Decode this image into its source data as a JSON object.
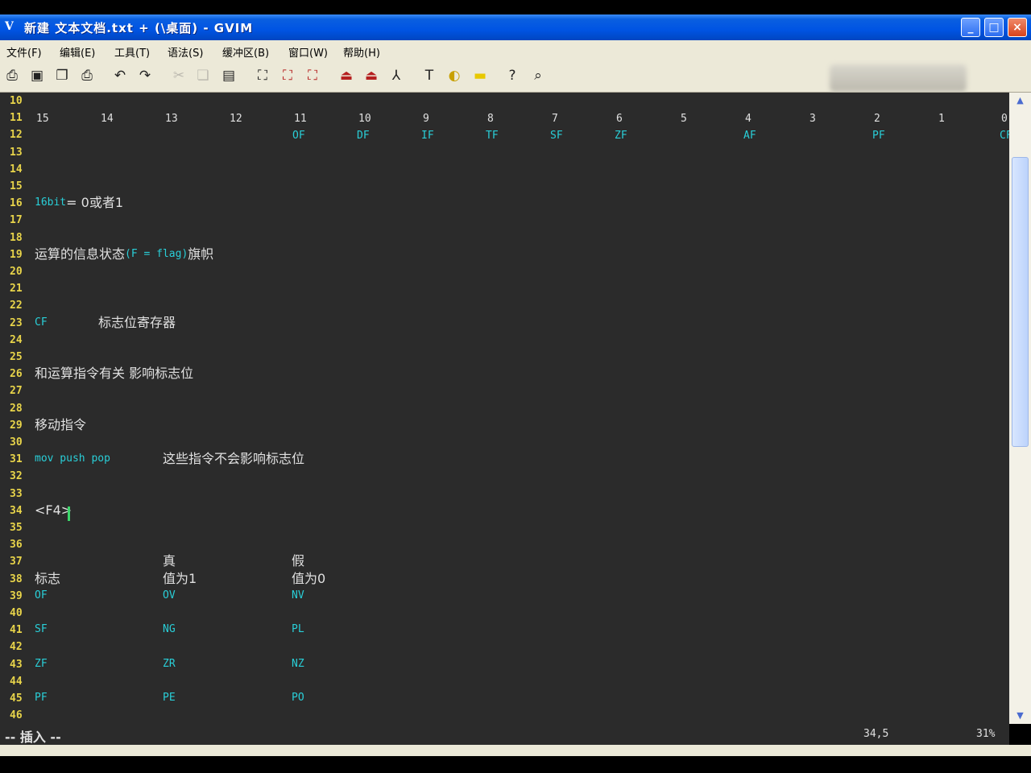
{
  "window": {
    "icon": "gvim-icon",
    "title": "新建 文本文档.txt + (\\桌面) - GVIM",
    "btn_min": "_",
    "btn_max": "□",
    "btn_close": "×"
  },
  "menu": [
    "文件(F)",
    "编辑(E)",
    "工具(T)",
    "语法(S)",
    "缓冲区(B)",
    "窗口(W)",
    "帮助(H)"
  ],
  "toolbar": [
    "open-icon",
    "save-icon",
    "save-all-icon",
    "print-icon",
    "undo-icon",
    "redo-icon",
    "cut-icon",
    "copy-icon",
    "paste-icon",
    "replace-icon",
    "find-next-icon",
    "find-prev-icon",
    "load-session-icon",
    "save-session-icon",
    "run-script-icon",
    "make-icon",
    "shell-icon",
    "ctags-icon",
    "help-icon",
    "find-help-icon"
  ],
  "editor": {
    "lines": [
      {
        "n": "10"
      },
      {
        "n": "11",
        "bits": [
          "15",
          "14",
          "13",
          "12",
          "11",
          "10",
          "9",
          "8",
          "7",
          "6",
          "5",
          "4",
          "3",
          "2",
          "1",
          "0"
        ]
      },
      {
        "n": "12",
        "flags": [
          "",
          "",
          "",
          "",
          "OF",
          "DF",
          "IF",
          "TF",
          "SF",
          "ZF",
          "",
          "AF",
          "",
          "PF",
          "",
          "CF"
        ]
      },
      {
        "n": "13"
      },
      {
        "n": "14"
      },
      {
        "n": "15"
      },
      {
        "n": "16",
        "segs": [
          {
            "text": "16bit",
            "cls": "c"
          },
          {
            "text": " = 0或者1",
            "cls": "w"
          }
        ]
      },
      {
        "n": "17"
      },
      {
        "n": "18"
      },
      {
        "n": "19",
        "segs": [
          {
            "text": "运算的信息状态",
            "cls": "w"
          },
          {
            "text": "(F = flag)",
            "cls": "c"
          },
          {
            "text": "旗帜",
            "cls": "w"
          }
        ]
      },
      {
        "n": "20"
      },
      {
        "n": "21"
      },
      {
        "n": "22"
      },
      {
        "n": "23",
        "segs": [
          {
            "text": "CF",
            "cls": "c"
          },
          {
            "text": "标志位寄存器",
            "cls": "w",
            "col": 122
          }
        ]
      },
      {
        "n": "24"
      },
      {
        "n": "25"
      },
      {
        "n": "26",
        "segs": [
          {
            "text": "和运算指令有关  影响标志位",
            "cls": "w"
          }
        ]
      },
      {
        "n": "27"
      },
      {
        "n": "28"
      },
      {
        "n": "29",
        "segs": [
          {
            "text": "移动指令",
            "cls": "w"
          }
        ]
      },
      {
        "n": "30"
      },
      {
        "n": "31",
        "segs": [
          {
            "text": "mov  push pop",
            "cls": "c"
          },
          {
            "text": "这些指令不会影响标志位",
            "cls": "w",
            "col": 202
          }
        ]
      },
      {
        "n": "32"
      },
      {
        "n": "33"
      },
      {
        "n": "34",
        "segs": [
          {
            "text": "<F4>",
            "cls": "w"
          }
        ]
      },
      {
        "n": "35"
      },
      {
        "n": "36"
      },
      {
        "n": "37",
        "segs": [
          {
            "text": "真",
            "cls": "w",
            "col": 202
          },
          {
            "text": "假",
            "cls": "w",
            "col": 362
          }
        ]
      },
      {
        "n": "38",
        "segs": [
          {
            "text": "标志",
            "cls": "w"
          },
          {
            "text": "值为1",
            "cls": "w",
            "col": 202
          },
          {
            "text": "值为0",
            "cls": "w",
            "col": 362
          }
        ]
      },
      {
        "n": "39",
        "segs": [
          {
            "text": "OF",
            "cls": "c"
          },
          {
            "text": "OV",
            "cls": "c",
            "col": 202
          },
          {
            "text": "NV",
            "cls": "c",
            "col": 362
          }
        ]
      },
      {
        "n": "40"
      },
      {
        "n": "41",
        "segs": [
          {
            "text": "SF",
            "cls": "c"
          },
          {
            "text": "NG",
            "cls": "c",
            "col": 202
          },
          {
            "text": "PL",
            "cls": "c",
            "col": 362
          }
        ]
      },
      {
        "n": "42"
      },
      {
        "n": "43",
        "segs": [
          {
            "text": "ZF",
            "cls": "c"
          },
          {
            "text": "ZR",
            "cls": "c",
            "col": 202
          },
          {
            "text": "NZ",
            "cls": "c",
            "col": 362
          }
        ]
      },
      {
        "n": "44"
      },
      {
        "n": "45",
        "segs": [
          {
            "text": "PF",
            "cls": "c"
          },
          {
            "text": "PE",
            "cls": "c",
            "col": 202
          },
          {
            "text": "PO",
            "cls": "c",
            "col": 362
          }
        ]
      },
      {
        "n": "46"
      }
    ]
  },
  "status": {
    "mode": "-- 插入 --",
    "position": "34,5",
    "percent": "31%"
  },
  "colors": {
    "background": "#2b2b2b",
    "line_number": "#e8d44a",
    "text": "#e0e0e0",
    "keyword": "#29cfd8",
    "cursor": "#3bd66a",
    "titlebar": "#0054e3"
  }
}
